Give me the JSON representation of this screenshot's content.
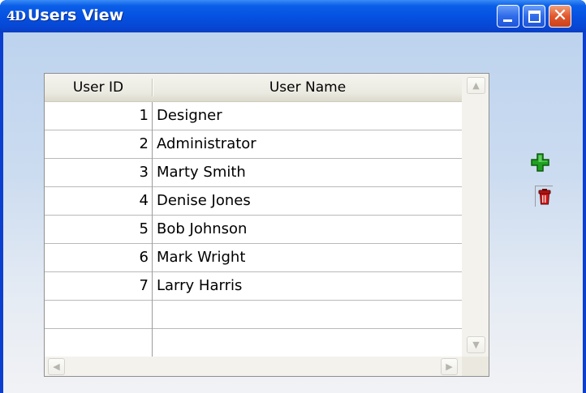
{
  "window": {
    "title": "Users View",
    "logo_text": "4D",
    "close_glyph": "✕"
  },
  "table": {
    "columns": [
      "User ID",
      "User Name"
    ],
    "rows": [
      {
        "id": "1",
        "name": "Designer"
      },
      {
        "id": "2",
        "name": "Administrator"
      },
      {
        "id": "3",
        "name": "Marty Smith"
      },
      {
        "id": "4",
        "name": "Denise Jones"
      },
      {
        "id": "5",
        "name": "Bob Johnson"
      },
      {
        "id": "6",
        "name": "Mark Wright"
      },
      {
        "id": "7",
        "name": "Larry Harris"
      },
      {
        "id": "",
        "name": ""
      },
      {
        "id": "",
        "name": ""
      }
    ]
  },
  "scrollbars": {
    "up_arrow": "▲",
    "down_arrow": "▼",
    "left_arrow": "◀",
    "right_arrow": "▶"
  },
  "actions": {
    "add_icon": "plus-icon",
    "delete_icon": "trash-icon"
  },
  "colors": {
    "titlebar": "#0550e0",
    "close_button": "#e2582c",
    "add_icon": "#1fa01f",
    "delete_icon": "#d01818"
  }
}
